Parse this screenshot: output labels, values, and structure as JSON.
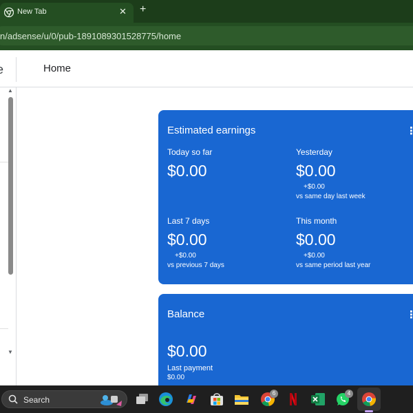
{
  "browser": {
    "tab_title": "New Tab",
    "close_glyph": "✕",
    "new_tab_glyph": "+",
    "url": "n/adsense/u/0/pub-1891089301528775/home"
  },
  "header": {
    "edge_glyph": "e",
    "page_title": "Home"
  },
  "earnings": {
    "title": "Estimated earnings",
    "menu_glyph": "⋮",
    "today_label": "Today so far",
    "today_value": "$0.00",
    "yesterday_label": "Yesterday",
    "yesterday_value": "$0.00",
    "yesterday_delta": "+$0.00",
    "yesterday_compare": "vs same day last week",
    "last7_label": "Last 7 days",
    "last7_value": "$0.00",
    "last7_delta": "+$0.00",
    "last7_compare": "vs previous 7 days",
    "month_label": "This month",
    "month_value": "$0.00",
    "month_delta": "+$0.00",
    "month_compare": "vs same period last year"
  },
  "balance": {
    "title": "Balance",
    "menu_glyph": "⋮",
    "value": "$0.00",
    "last_payment_label": "Last payment",
    "last_payment_value": "$0.00"
  },
  "taskbar": {
    "search_label": "Search",
    "whatsapp_badge": "4",
    "chrome_badge": "6"
  },
  "colors": {
    "card_blue": "#1967d2",
    "browser_green": "#244e22",
    "taskbar": "#1f1f1f"
  },
  "icons": [
    "chrome-icon",
    "search-icon",
    "task-view-icon",
    "edge-icon",
    "copilot-icon",
    "store-icon",
    "file-explorer-icon",
    "netflix-icon",
    "excel-icon",
    "whatsapp-icon"
  ]
}
